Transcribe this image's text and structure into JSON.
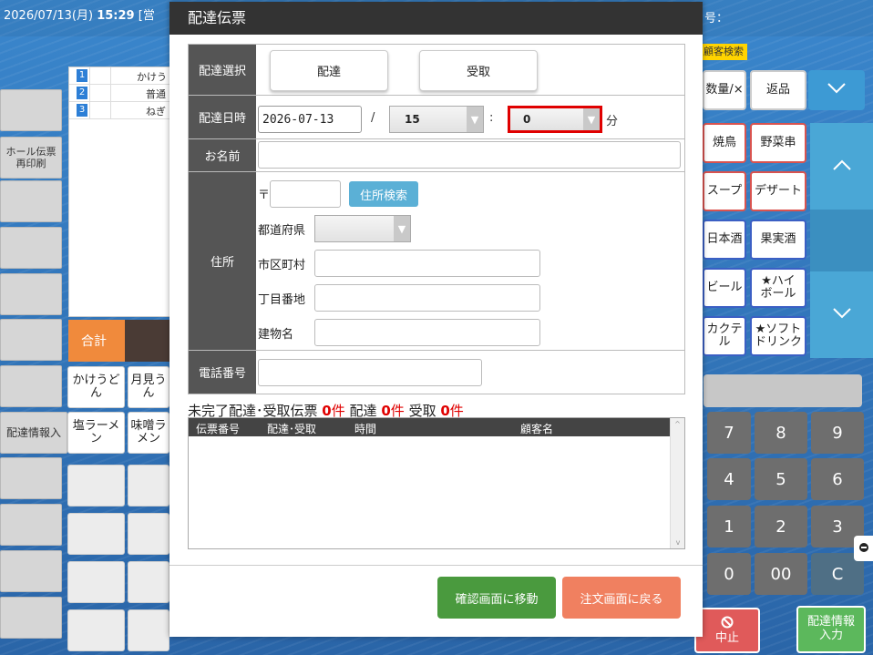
{
  "topbar": {
    "date": "2026/07/13(月)",
    "time": "15:29",
    "status_partial": "[営",
    "right_label": "号：",
    "customer_search": "顧客検索"
  },
  "left_buttons": {
    "hall_reprint": "ホール伝票\n再印刷",
    "delivery_info_input": "配達情報入"
  },
  "order_list": [
    {
      "num": "1",
      "name": "かけう"
    },
    {
      "num": "2",
      "name": "普通"
    },
    {
      "num": "3",
      "name": "ねぎ"
    }
  ],
  "total_label": "合計",
  "product_buttons": [
    "かけうど\nん",
    "月見う\nん",
    "塩ラーメ\nン",
    "味噌ラ\nメン"
  ],
  "right_panel": {
    "qty_x": "数量/×",
    "return": "返品",
    "categories": [
      "焼鳥",
      "野菜串",
      "スープ",
      "デザート",
      "日本酒",
      "果実酒",
      "ビール",
      "★ハイ\nボール",
      "カクテ\nル",
      "★ソフト\nドリンク"
    ],
    "keys": [
      "7",
      "8",
      "9",
      "4",
      "5",
      "6",
      "1",
      "2",
      "3",
      "0",
      "00",
      "C"
    ],
    "stop": "中止",
    "delivery_info_input": "配達情報\n入力"
  },
  "modal": {
    "title": "配達伝票",
    "delivery_select_label": "配達選択",
    "delivery_option": "配達",
    "pickup_option": "受取",
    "datetime_label": "配達日時",
    "date_value": "2026-07-13",
    "date_sep": "/",
    "hour_value": "15",
    "time_sep": ":",
    "minute_value": "0",
    "minute_unit": "分",
    "name_label": "お名前",
    "address_label": "住所",
    "postal_mark": "〒",
    "address_search": "住所検索",
    "prefecture_label": "都道府県",
    "city_label": "市区町村",
    "street_label": "丁目番地",
    "building_label": "建物名",
    "phone_label": "電話番号",
    "pending_prefix": "未完了配達･受取伝票",
    "pending_total": "0",
    "pending_unit": "件",
    "pending_delivery_label": "配達",
    "pending_delivery": "0",
    "pending_pickup_label": "受取",
    "pending_pickup": "0",
    "list_headers": [
      "伝票番号",
      "配達･受取",
      "時間",
      "顧客名"
    ],
    "confirm_button": "確認画面に移動",
    "back_button": "注文画面に戻る"
  },
  "colors": {
    "highlight_border": "#e00000",
    "count_red": "#e00000",
    "confirm_green": "#4a9a3e",
    "back_orange": "#f08060"
  }
}
